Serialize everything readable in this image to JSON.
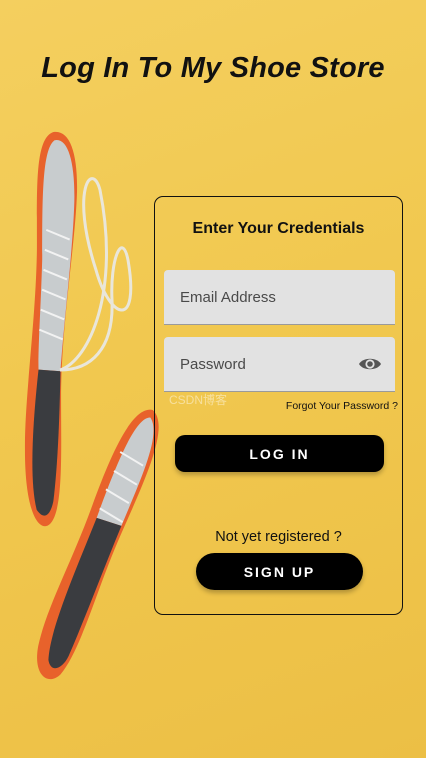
{
  "header": {
    "title": "Log In To My Shoe Store"
  },
  "form": {
    "heading": "Enter Your Credentials",
    "email_placeholder": "Email Address",
    "password_placeholder": "Password",
    "watermark": "CSDN博客",
    "forgot_label": "Forgot Your Password ?",
    "login_label": "LOG IN",
    "not_registered_text": "Not yet registered ?",
    "signup_label": "SIGN UP"
  },
  "icons": {
    "password_toggle": "eye-icon"
  },
  "colors": {
    "background": "#f1c84f",
    "button": "#000000",
    "field": "#e2e2e2"
  }
}
